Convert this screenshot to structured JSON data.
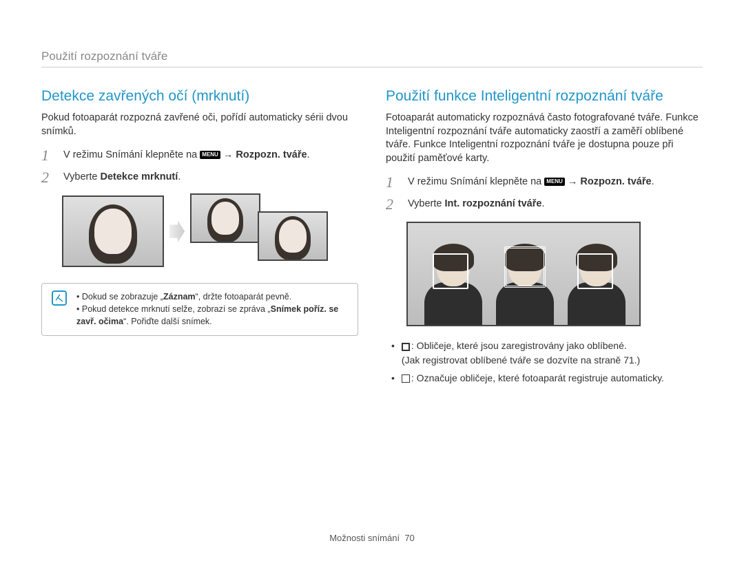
{
  "breadcrumb": "Použití rozpoznání tváře",
  "menu_chip": "MENU",
  "left": {
    "title": "Detekce zavřených očí (mrknutí)",
    "intro": "Pokud fotoaparát rozpozná zavřené oči, pořídí automaticky sérii dvou snímků.",
    "step1_a": "V režimu Snímání klepněte na ",
    "step1_b": " → Rozpozn. tváře",
    "step2_a": "Vyberte ",
    "step2_b": "Detekce mrknutí",
    "note1_a": "Dokud se zobrazuje „",
    "note1_b": "Záznam",
    "note1_c": "“, držte fotoaparát pevně.",
    "note2_a": "Pokud detekce mrknutí selže, zobrazí se zpráva „",
    "note2_b": "Snímek poříz. se zavř. očima",
    "note2_c": "“. Pořiďte další snímek."
  },
  "right": {
    "title": "Použití funkce Inteligentní rozpoznání tváře",
    "intro": "Fotoaparát automaticky rozpoznává často fotografované tváře. Funkce Inteligentní rozpoznání tváře automaticky zaostří a zaměří oblíbené tváře. Funkce Inteligentní rozpoznání tváře je dostupna pouze při použití paměťové karty.",
    "step1_a": "V režimu Snímání klepněte na ",
    "step1_b": " → Rozpozn. tváře",
    "step2_a": "Vyberte ",
    "step2_b": "Int. rozpoznání tváře",
    "legend1_a": ": Obličeje, které jsou zaregistrovány jako oblíbené.",
    "legend1_b": "(Jak registrovat oblíbené tváře se dozvíte na straně 71.)",
    "legend2": ": Označuje obličeje, které fotoaparát registruje automaticky."
  },
  "footer_label": "Možnosti snímání",
  "footer_page": "70"
}
